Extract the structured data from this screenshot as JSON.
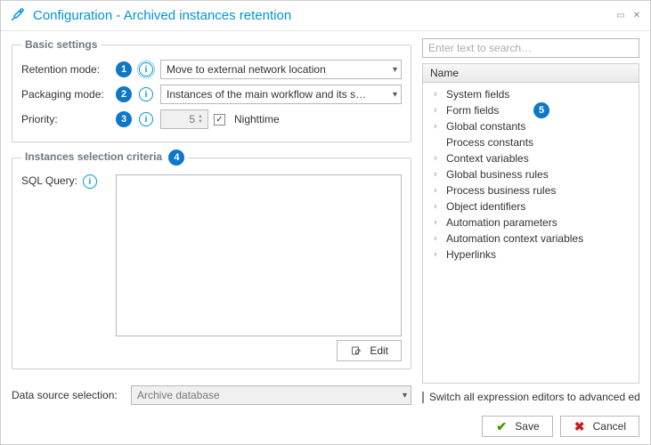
{
  "window": {
    "title": "Configuration - Archived instances retention"
  },
  "basic": {
    "legend": "Basic settings",
    "retention_label": "Retention mode:",
    "retention_value": "Move to external network location",
    "packaging_label": "Packaging mode:",
    "packaging_value": "Instances of the main workflow and its s…",
    "priority_label": "Priority:",
    "priority_value": "5",
    "nighttime_label": "Nighttime",
    "badges": {
      "retention": "1",
      "packaging": "2",
      "priority": "3"
    }
  },
  "criteria": {
    "legend": "Instances selection criteria",
    "badge": "4",
    "sql_label": "SQL Query:",
    "edit_label": "Edit",
    "ds_label": "Data source selection:",
    "ds_value": "Archive database"
  },
  "search": {
    "placeholder": "Enter text to search…"
  },
  "tree": {
    "header": "Name",
    "badge": "5",
    "items": [
      {
        "label": "System fields",
        "expand": true
      },
      {
        "label": "Form fields",
        "expand": true
      },
      {
        "label": "Global constants",
        "expand": true
      },
      {
        "label": "Process constants",
        "expand": false
      },
      {
        "label": "Context variables",
        "expand": true
      },
      {
        "label": "Global business rules",
        "expand": true
      },
      {
        "label": "Process business rules",
        "expand": true
      },
      {
        "label": "Object identifiers",
        "expand": true
      },
      {
        "label": "Automation parameters",
        "expand": true
      },
      {
        "label": "Automation context variables",
        "expand": true
      },
      {
        "label": "Hyperlinks",
        "expand": true
      }
    ]
  },
  "switch": {
    "label": "Switch all expression editors to advanced edit …"
  },
  "footer": {
    "save": "Save",
    "cancel": "Cancel"
  }
}
